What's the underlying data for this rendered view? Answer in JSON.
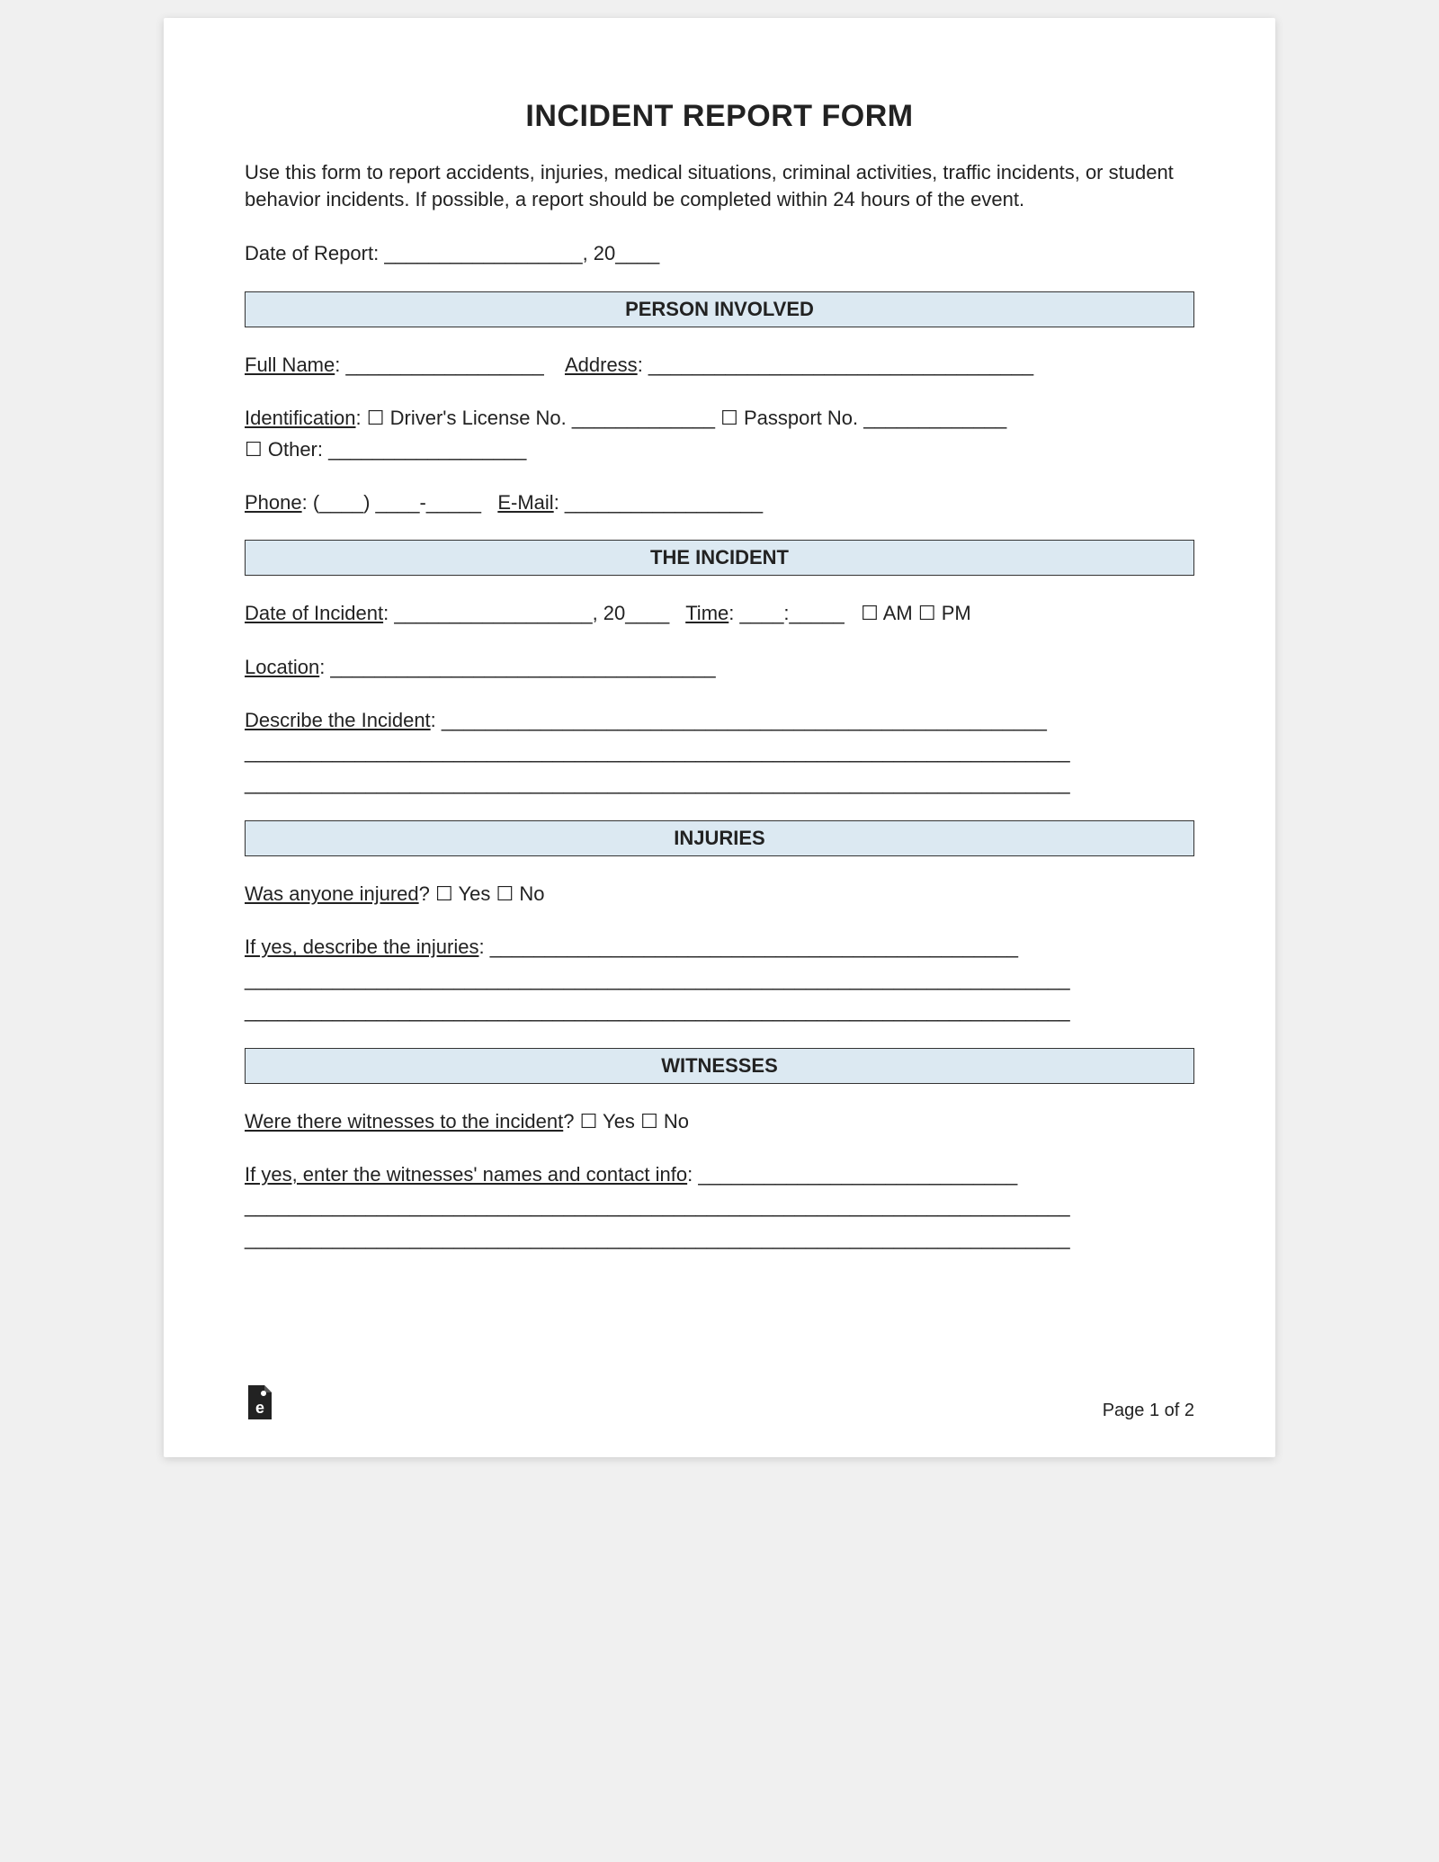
{
  "title": "INCIDENT REPORT FORM",
  "intro": "Use this form to report accidents, injuries, medical situations, criminal activities, traffic incidents, or student behavior incidents. If possible, a report should be completed within 24 hours of the event.",
  "dateOfReport": {
    "label": "Date of Report:",
    "blank": "__________________",
    "sep": ", 20",
    "yearBlank": "____"
  },
  "sections": {
    "person": {
      "header": "PERSON INVOLVED",
      "fullName": {
        "label": "Full Name",
        "blank": ": __________________"
      },
      "address": {
        "label": "Address",
        "blank": ": ___________________________________"
      },
      "identification": {
        "label": "Identification",
        "drivers": "Driver's License No.",
        "driversBlank": " _____________",
        "passport": "Passport No.",
        "passportBlank": " _____________",
        "other": "Other:",
        "otherBlank": " __________________"
      },
      "phone": {
        "label": "Phone",
        "blank": ": (____) ____-_____"
      },
      "email": {
        "label": "E-Mail",
        "blank": ": __________________"
      }
    },
    "incident": {
      "header": "THE INCIDENT",
      "dateOfIncident": {
        "label": "Date of Incident",
        "blank": ": __________________",
        "sep": ", 20",
        "yearBlank": "____"
      },
      "time": {
        "label": "Time",
        "blank": ": ____:_____",
        "am": "AM",
        "pm": "PM"
      },
      "location": {
        "label": "Location",
        "blank": ": ___________________________________"
      },
      "describe": {
        "label": "Describe the Incident",
        "blank": ": _______________________________________________________",
        "line2": "___________________________________________________________________________",
        "line3": "___________________________________________________________________________"
      }
    },
    "injuries": {
      "header": "INJURIES",
      "wasInjured": {
        "label": "Was anyone injured",
        "yes": "Yes",
        "no": "No"
      },
      "describe": {
        "label": "If yes, describe the injuries",
        "blank": ": ________________________________________________",
        "line2": "___________________________________________________________________________",
        "line3": "___________________________________________________________________________"
      }
    },
    "witnesses": {
      "header": "WITNESSES",
      "wereThere": {
        "label": "Were there witnesses to the incident",
        "yes": "Yes",
        "no": "No"
      },
      "enter": {
        "label": "If yes, enter the witnesses' names and contact info",
        "blank": ": _____________________________",
        "line2": "___________________________________________________________________________",
        "line3": "___________________________________________________________________________"
      }
    }
  },
  "footer": {
    "pageLabel": "Page 1 of 2"
  },
  "glyphs": {
    "checkbox": "☐"
  }
}
